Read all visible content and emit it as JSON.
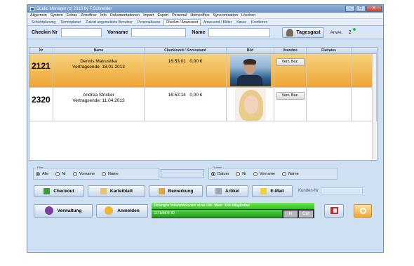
{
  "window": {
    "title": "Studio Manager (c) 2010 by F.Schneider"
  },
  "menu": [
    "Allgemein",
    "System",
    "Extras",
    "Zirnoffner",
    "Info",
    "Dokumentationen",
    "Import",
    "Export",
    "Personal",
    "Homeoffice",
    "Syncronisation",
    "Löschen"
  ],
  "tabs": [
    "Schichtplanung",
    "Terminplaner",
    "Zuletzt angemeldete Benutzer",
    "Personalkasse",
    "Checkin / Anwesend",
    "Anwesend / Bilder",
    "Kasse",
    "Kreditoren"
  ],
  "active_tab": 4,
  "search": {
    "checkin_label": "Checkin Nr",
    "vorname_label": "Vorname",
    "name_label": "Name",
    "tagesgast_label": "Tagesgast",
    "anwe_label": "Anwe.",
    "anwe_count": "2"
  },
  "columns": [
    "Nr",
    "Name",
    "Checkinzeit / Kontostand",
    "Bild",
    "Verzehre",
    "Flatrates"
  ],
  "rows": [
    {
      "nr": "2121",
      "name": "Dennis Matrushka",
      "vertrag": "Vertragsende: 18.01.2013",
      "time": "16:53:01",
      "konto": "0,00 €",
      "verz_button": "Verz. Bez."
    },
    {
      "nr": "2320",
      "name": "Andrea Stricker",
      "vertrag": "Vertragsende: 11.04.2013",
      "time": "16:53:14",
      "konto": "0,00 €",
      "verz_button": "Verz. Bez."
    }
  ],
  "filter": {
    "legend": "Filter",
    "options": [
      "Alle",
      "Nr",
      "Vorname",
      "Name"
    ],
    "selected": 0
  },
  "order": {
    "legend": "Ordnen",
    "options": [
      "Datum",
      "Nr",
      "Vorname",
      "Name"
    ],
    "selected": 0
  },
  "actions": [
    "Checkout",
    "Karteiblatt",
    "Bemerkung",
    "Artikel",
    "E-Mail"
  ],
  "kunden_label": "Kunden-Nr",
  "status": {
    "verwaltung": "Verwaltung",
    "anmelden": "Anmelden",
    "info": "Dounglo Informationen sind OK! Max: 300 Mitglieder",
    "rfid": "CR188RFID",
    "in": "In",
    "out": "Out"
  },
  "colors": {
    "selected_row": "#eea534",
    "green": "#2fbf1f",
    "window_bg": "#cfe0f3"
  }
}
